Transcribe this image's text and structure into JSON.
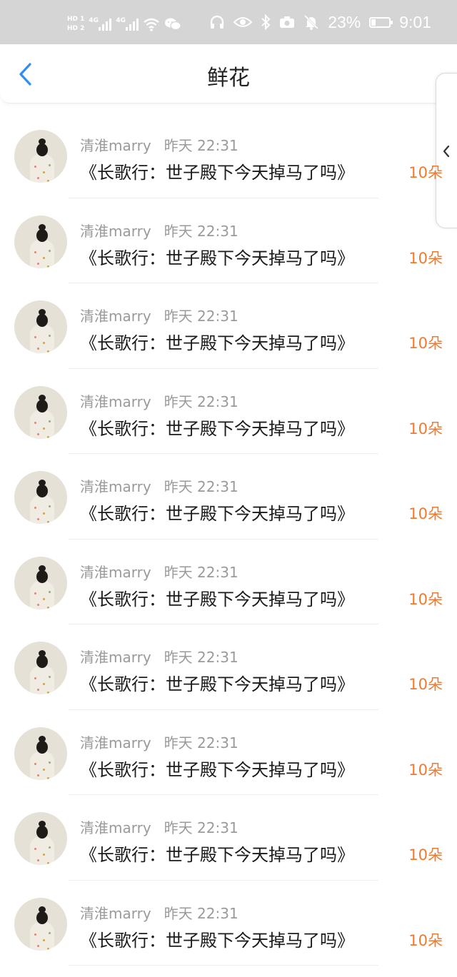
{
  "status_bar": {
    "sim1_label": "HD 1",
    "sim2_label": "HD 2",
    "net1": "4G",
    "net2": "4G",
    "battery_percent": "23%",
    "battery_level": 0.23,
    "time": "9:01",
    "icons": [
      "signal-icon",
      "wifi-icon",
      "wechat-icon",
      "headphones-icon",
      "eye-icon",
      "bluetooth-icon",
      "camera-icon",
      "mute-bell-icon",
      "battery-icon"
    ]
  },
  "header": {
    "title": "鲜花",
    "back_icon": "chevron-left-icon"
  },
  "side_handle": {
    "icon": "chevron-left-icon"
  },
  "colors": {
    "accent": "#2f8ef0",
    "count": "#f07a2e",
    "meta": "#9a9a9a",
    "text": "#1a1a1a"
  },
  "items": [
    {
      "user": "清淮marry",
      "time": "昨天 22:31",
      "book": "《长歌行：世子殿下今天掉马了吗》",
      "count": "10朵"
    },
    {
      "user": "清淮marry",
      "time": "昨天 22:31",
      "book": "《长歌行：世子殿下今天掉马了吗》",
      "count": "10朵"
    },
    {
      "user": "清淮marry",
      "time": "昨天 22:31",
      "book": "《长歌行：世子殿下今天掉马了吗》",
      "count": "10朵"
    },
    {
      "user": "清淮marry",
      "time": "昨天 22:31",
      "book": "《长歌行：世子殿下今天掉马了吗》",
      "count": "10朵"
    },
    {
      "user": "清淮marry",
      "time": "昨天 22:31",
      "book": "《长歌行：世子殿下今天掉马了吗》",
      "count": "10朵"
    },
    {
      "user": "清淮marry",
      "time": "昨天 22:31",
      "book": "《长歌行：世子殿下今天掉马了吗》",
      "count": "10朵"
    },
    {
      "user": "清淮marry",
      "time": "昨天 22:31",
      "book": "《长歌行：世子殿下今天掉马了吗》",
      "count": "10朵"
    },
    {
      "user": "清淮marry",
      "time": "昨天 22:31",
      "book": "《长歌行：世子殿下今天掉马了吗》",
      "count": "10朵"
    },
    {
      "user": "清淮marry",
      "time": "昨天 22:31",
      "book": "《长歌行：世子殿下今天掉马了吗》",
      "count": "10朵"
    },
    {
      "user": "清淮marry",
      "time": "昨天 22:31",
      "book": "《长歌行：世子殿下今天掉马了吗》",
      "count": "10朵"
    }
  ]
}
